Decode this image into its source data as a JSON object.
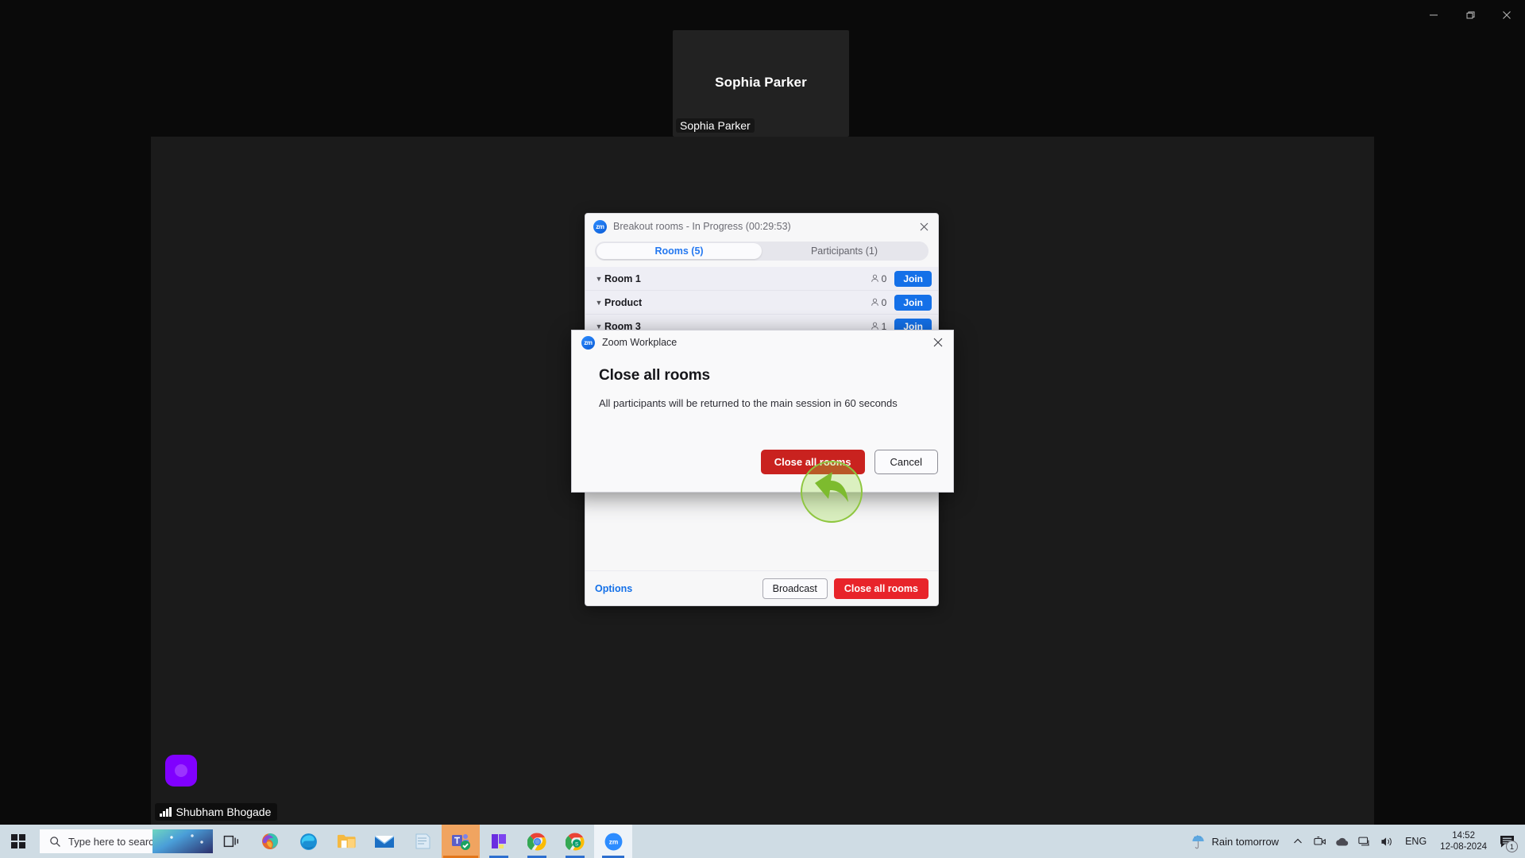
{
  "window": {
    "minimize_label": "Minimize",
    "restore_label": "Restore",
    "close_label": "Close"
  },
  "video_tile": {
    "display_name": "Sophia Parker",
    "name_badge": "Sophia Parker"
  },
  "stage": {
    "host_label": "Shubham Bhogade"
  },
  "breakout": {
    "title": "Breakout rooms - In Progress (00:29:53)",
    "logo_text": "zm",
    "tabs": [
      {
        "label": "Rooms (5)",
        "active": true
      },
      {
        "label": "Participants (1)",
        "active": false
      }
    ],
    "rooms": [
      {
        "name": "Room 1",
        "count": "0",
        "join_label": "Join"
      },
      {
        "name": "Product",
        "count": "0",
        "join_label": "Join"
      },
      {
        "name": "Room 3",
        "count": "1",
        "join_label": "Join"
      }
    ],
    "footer": {
      "options_label": "Options",
      "broadcast_label": "Broadcast",
      "close_all_label": "Close all rooms"
    }
  },
  "modal": {
    "app_title": "Zoom Workplace",
    "logo_text": "zm",
    "heading": "Close all rooms",
    "message": "All participants will be returned to the main session in 60 seconds",
    "confirm_label": "Close all rooms",
    "cancel_label": "Cancel"
  },
  "taskbar": {
    "search_placeholder": "Type here to search",
    "weather_text": "Rain tomorrow",
    "language": "ENG",
    "time": "14:52",
    "date": "12-08-2024",
    "notification_count": "1"
  },
  "colors": {
    "zoom_blue": "#1470e8",
    "danger_red": "#e8242a",
    "dialog_red": "#c9221f",
    "highlight_green": "#8ec63f",
    "purple_widget": "#8000ff"
  }
}
